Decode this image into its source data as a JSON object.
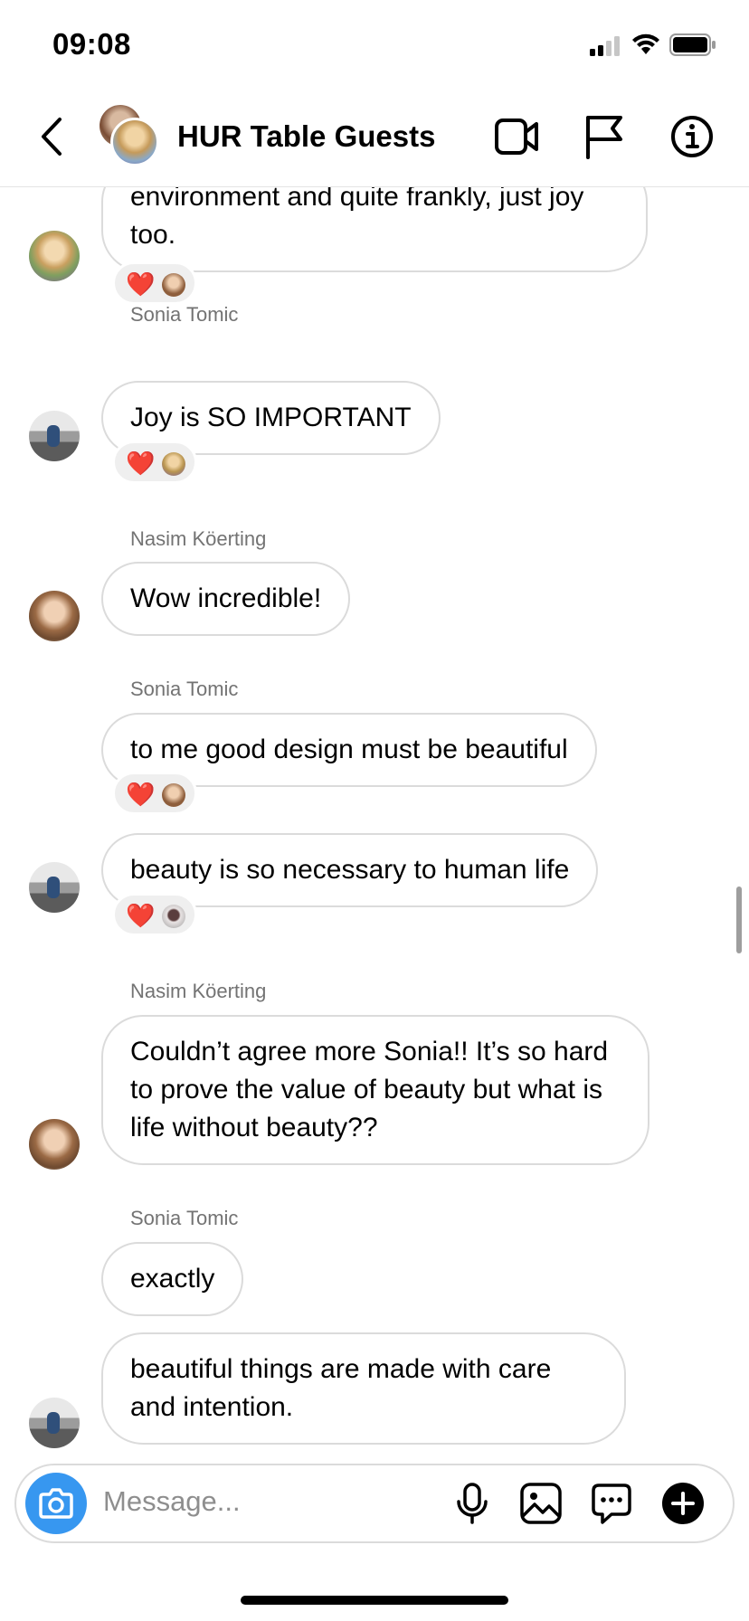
{
  "status_bar": {
    "time": "09:08"
  },
  "header": {
    "title": "HUR Table Guests",
    "icons": [
      "back-icon",
      "video-call-icon",
      "flag-icon",
      "info-icon"
    ]
  },
  "messages": [
    {
      "text": "environment and quite frankly, just joy too.",
      "reaction": "❤️"
    },
    {
      "sender": "Sonia Tomic",
      "text": "Joy is SO IMPORTANT",
      "reaction": "❤️"
    },
    {
      "sender": "Nasim Köerting",
      "text": "Wow incredible!"
    },
    {
      "sender": "Sonia Tomic",
      "text": "to me good design must be beautiful",
      "reaction": "❤️"
    },
    {
      "text": "beauty is so necessary to human life",
      "reaction": "❤️"
    },
    {
      "sender": "Nasim Köerting",
      "text": "Couldn’t agree more Sonia!! It’s so hard to prove the value of beauty but what is life without beauty??"
    },
    {
      "sender": "Sonia Tomic",
      "text": "exactly"
    },
    {
      "text": "beautiful things are made with care and intention."
    }
  ],
  "composer": {
    "placeholder": "Message...",
    "icons": [
      "camera-icon",
      "microphone-icon",
      "gallery-icon",
      "sticker-icon",
      "plus-icon"
    ]
  },
  "colors": {
    "accent": "#3797f0",
    "heart": "#e0163d",
    "bubble_border": "#dbdbdb",
    "sender": "#737373"
  }
}
